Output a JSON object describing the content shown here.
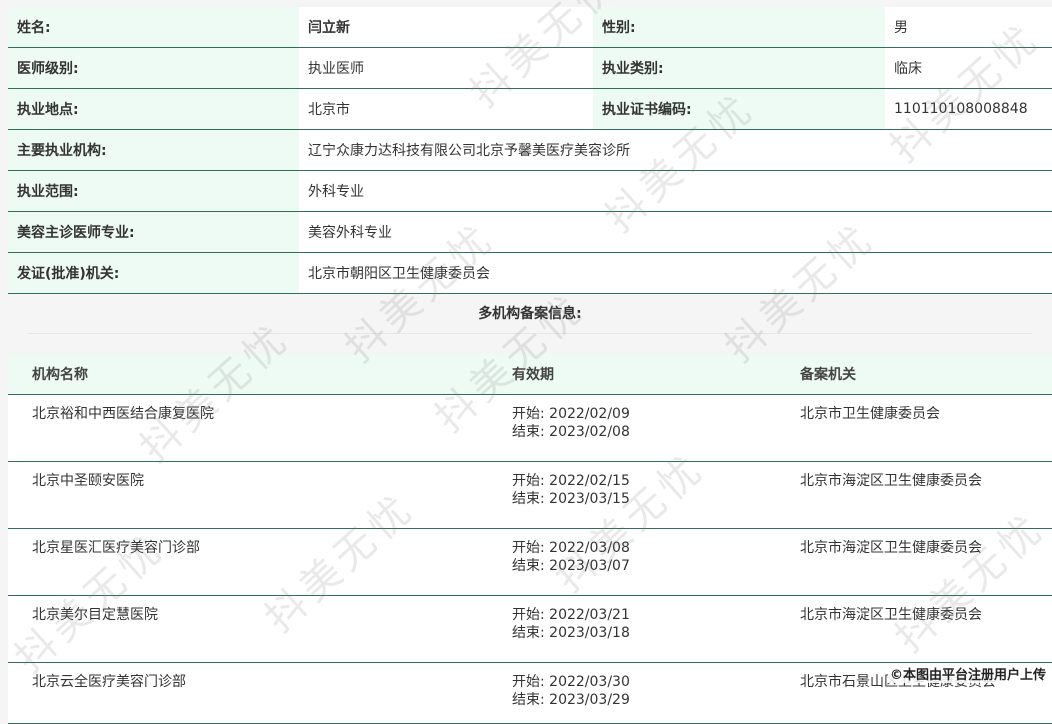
{
  "info": {
    "rows": [
      [
        "姓名:",
        "闫立新",
        "性别:",
        "男"
      ],
      [
        "医师级别:",
        "执业医师",
        "执业类别:",
        "临床"
      ],
      [
        "执业地点:",
        "北京市",
        "执业证书编码:",
        "110110108008848"
      ],
      [
        "主要执业机构:",
        "辽宁众康力达科技有限公司北京予馨美医疗美容诊所"
      ],
      [
        "执业范围:",
        "外科专业"
      ],
      [
        "美容主诊医师专业:",
        "美容外科专业"
      ],
      [
        "发证(批准)机关:",
        "北京市朝阳区卫生健康委员会"
      ]
    ]
  },
  "multi": {
    "title": "多机构备案信息:",
    "headers": [
      "机构名称",
      "有效期",
      "备案机关"
    ],
    "records": [
      {
        "name": "北京裕和中西医结合康复医院",
        "start": "开始:  2022/02/09",
        "end": "结束:  2023/02/08",
        "authority": "北京市卫生健康委员会"
      },
      {
        "name": "北京中圣颐安医院",
        "start": "开始:  2022/02/15",
        "end": "结束:  2023/03/15",
        "authority": "北京市海淀区卫生健康委员会"
      },
      {
        "name": "北京星医汇医疗美容门诊部",
        "start": "开始:  2022/03/08",
        "end": "结束:  2023/03/07",
        "authority": "北京市海淀区卫生健康委员会"
      },
      {
        "name": "北京美尔目定慧医院",
        "start": "开始:  2022/03/21",
        "end": "结束:  2023/03/18",
        "authority": "北京市海淀区卫生健康委员会"
      },
      {
        "name": "北京云全医疗美容门诊部",
        "start": "开始:  2022/03/30",
        "end": "结束:  2023/03/29",
        "authority": "北京市石景山区卫生健康委员会"
      }
    ]
  },
  "watermark": {
    "text": "抖美无忧"
  },
  "footer": {
    "text": "©本图由平台注册用户上传"
  }
}
